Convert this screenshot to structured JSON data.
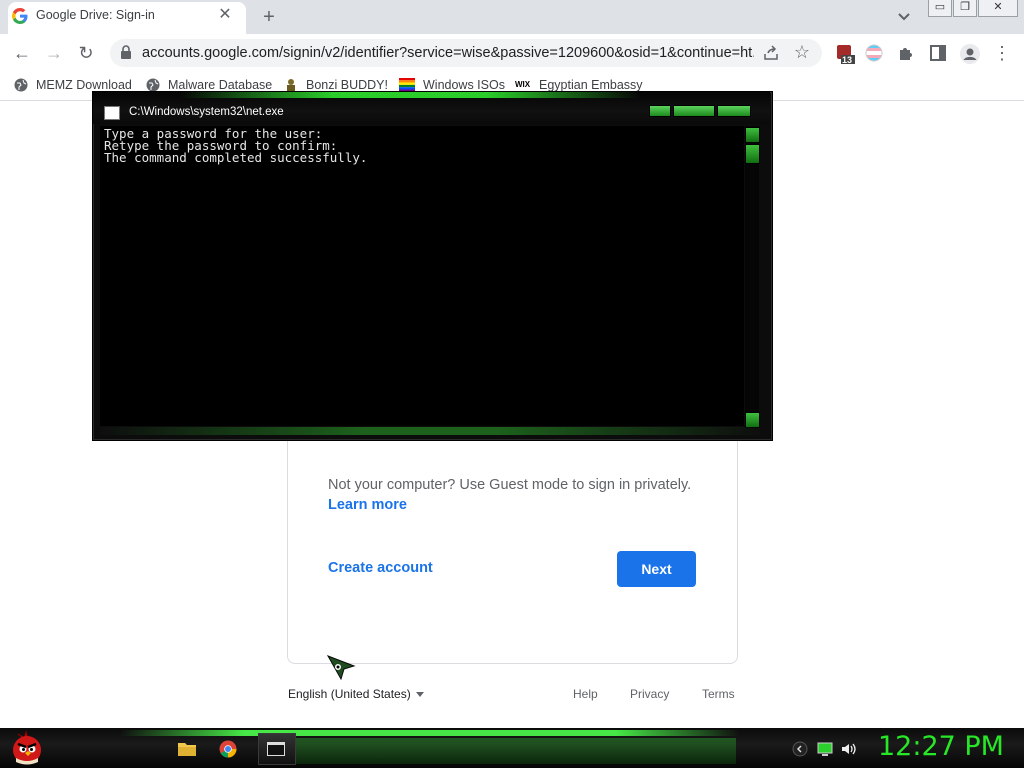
{
  "browser": {
    "tab_title": "Google Drive: Sign-in",
    "tab_close": "✕",
    "new_tab": "+",
    "window_controls": [
      "▭",
      "❐",
      "✕"
    ],
    "url": "accounts.google.com/signin/v2/identifier?service=wise&passive=1209600&osid=1&continue=ht...",
    "extension_badge": "13",
    "nav": {
      "back": "←",
      "forward": "→",
      "reload": "↻",
      "menu": "⋮",
      "star": "☆"
    }
  },
  "bookmarks": [
    {
      "label": "MEMZ Download",
      "icon": "globe-icon"
    },
    {
      "label": "Malware Database",
      "icon": "globe-icon"
    },
    {
      "label": "Bonzi BUDDY!",
      "icon": "bonzi-icon"
    },
    {
      "label": "Windows ISOs",
      "icon": "rainbow-flag-icon"
    },
    {
      "label": "Egyptian Embassy",
      "icon": "wix-icon"
    }
  ],
  "wix_logo": "WIX",
  "console": {
    "title": "C:\\Windows\\system32\\net.exe",
    "lines": [
      "Type a password for the user:",
      "Retype the password to confirm:",
      "The command completed successfully."
    ]
  },
  "signin": {
    "guest_text": "Not your computer? Use Guest mode to sign in privately.",
    "learn_more": "Learn more",
    "create_account": "Create account",
    "next": "Next"
  },
  "footer": {
    "language": "English (United States)",
    "links": [
      "Help",
      "Privacy",
      "Terms"
    ]
  },
  "taskbar": {
    "clock": "12:27 PM",
    "accent_color": "#27e827"
  }
}
